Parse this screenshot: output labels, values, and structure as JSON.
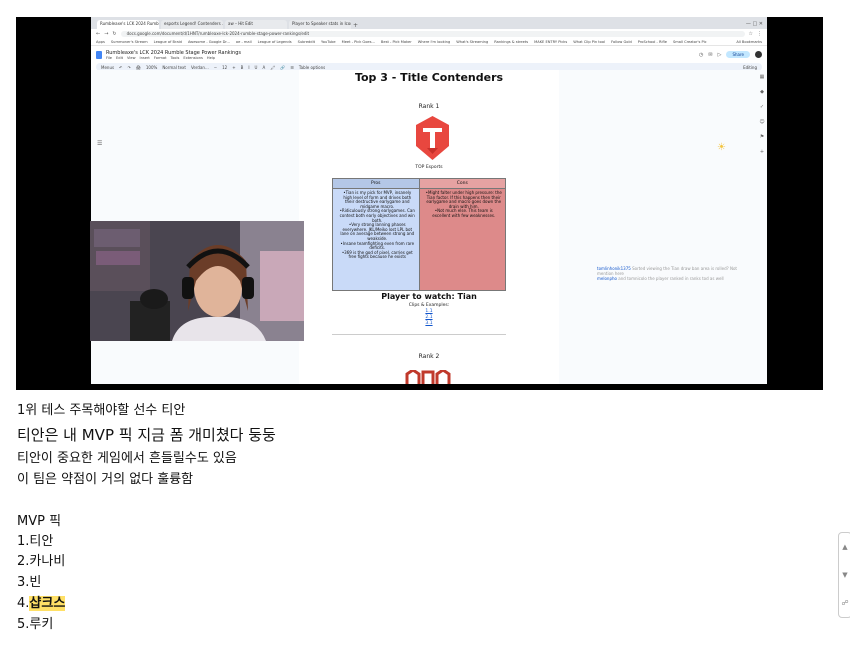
{
  "browser": {
    "tabs": [
      "Rumbleaxe's LCK 2024 Rumble...",
      "esports Legend! Contenders ...",
      "aw – Hit Edit",
      "Player to Speaker stats in Icon...",
      "+"
    ],
    "window_controls": "— □ ✕",
    "url": "docs.google.com/document/d/1HNT/rumbleaxe-lck-2024-rumble-stage-power-rankings/edit",
    "bookmarks": [
      "Apps",
      "Summoner's Stream",
      "League of Braid",
      "Awesome - Google Dr...",
      "oe - mail",
      "League of Legends",
      "Subreddit",
      "YouTube",
      "Meet - Pick Goes...",
      "Best - Pick Maker",
      "Where I'm looking",
      "What's Streaming",
      "Rankings & streets",
      "MAKE ENTRY Picks",
      "What Clip Pin tool",
      "Follow Gold",
      "ProSchool - Rifle",
      "Small Creator's Pic"
    ],
    "bookmarks_right": "All Bookmarks"
  },
  "doc": {
    "title": "Rumbleaxe's LCK 2024 Rumble Stage Power Rankings",
    "menu": [
      "File",
      "Edit",
      "View",
      "Insert",
      "Format",
      "Tools",
      "Extensions",
      "Help"
    ],
    "share_label": "Share",
    "toolbar_items": [
      "Menus",
      "↶",
      "↷",
      "🖨",
      "100%",
      "Normal text",
      "Verdan...",
      "−",
      "12",
      "+",
      "B",
      "I",
      "U",
      "A",
      "🖍",
      "🔗",
      "☰",
      "Table options"
    ],
    "editing_label": "Editing",
    "heading": "Top 3 - Title Contenders",
    "rank1_label": "Rank 1",
    "team_name": "TOP Esports",
    "table": {
      "pros_header": "Pros",
      "cons_header": "Cons",
      "pros": [
        "Tian is my pick for MVP, insanely high level of form and drives both their destructive earlygame and midgame macro.",
        "Ridiculously strong earlygames. Can contest both early objectives and win both.",
        "Very strong lanning phases everywhere. JKL/Meiko lost LPL bot lane on average between strong and weakside.",
        "Insane teamfighting even from rare deficits.",
        "369 is the god of pixel, carries get free fights because he exists"
      ],
      "cons": [
        "Might falter under high pressure: the Tian factor. If this happens then their earlygame and macro goes down the drain with him.",
        "Not much else. This team is excellent with few weaknesses."
      ]
    },
    "player_watch": "Player to watch: Tian",
    "clips_label": "Clips & Examples:",
    "clips": [
      "1.1",
      "2.1",
      "3.1"
    ],
    "rank2_label": "Rank 2",
    "comment_author": "tomlinhonik1375",
    "comment_text": "Sorted viewing the Tian draw ban area is rolled? Not mention here",
    "comment_author2": "melonpho",
    "comment_text2": "and tomnicolo the player ranked in ranks tod as well",
    "colors": {
      "accent": "#1a73e8",
      "pros": "#c9daf8",
      "cons": "#dd8a8a",
      "logo_red": "#e8473f"
    }
  },
  "caption": {
    "line1": "1위 테스 주목해야할 선수 티안",
    "line2": "티안은 내 MVP 픽 지금 폼 개미쳤다 둥둥",
    "line3": "티안이 중요한 게임에서 흔들릴수도 있음",
    "line4": "이 팀은 약점이 거의 없다 훌륭함",
    "mvp_title": "MVP 픽",
    "mvp_list": [
      "1.티안",
      "2.카나비",
      "3.빈"
    ],
    "mvp4_prefix": "4.",
    "mvp4_name": "샵크스",
    "mvp5": "5.루키"
  }
}
